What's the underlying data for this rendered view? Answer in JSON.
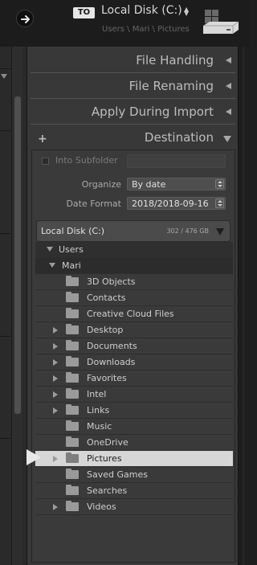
{
  "header": {
    "to_badge": "TO",
    "destination_name": "Local Disk (C:)",
    "destination_path": "Users \\ Mari \\ Pictures",
    "caret": "▲▼"
  },
  "panel": {
    "sections": [
      {
        "label": "File Handling",
        "state": "collapsed"
      },
      {
        "label": "File Renaming",
        "state": "collapsed"
      },
      {
        "label": "Apply During Import",
        "state": "collapsed"
      },
      {
        "label": "Destination",
        "state": "expanded"
      }
    ],
    "plus_icon": "+",
    "into_subfolder": {
      "label": "Into Subfolder",
      "value": ""
    },
    "organize": {
      "label": "Organize",
      "value": "By date"
    },
    "date_format": {
      "label": "Date Format",
      "value": "2018/2018-09-16"
    },
    "disk": {
      "name": "Local Disk (C:)",
      "space": "302 / 476 GB"
    },
    "tree": {
      "users": "Users",
      "mari": "Mari",
      "folders": [
        {
          "name": "3D Objects",
          "expandable": false
        },
        {
          "name": "Contacts",
          "expandable": false
        },
        {
          "name": "Creative Cloud Files",
          "expandable": false
        },
        {
          "name": "Desktop",
          "expandable": true
        },
        {
          "name": "Documents",
          "expandable": true
        },
        {
          "name": "Downloads",
          "expandable": true
        },
        {
          "name": "Favorites",
          "expandable": true
        },
        {
          "name": "Intel",
          "expandable": true
        },
        {
          "name": "Links",
          "expandable": true
        },
        {
          "name": "Music",
          "expandable": false
        },
        {
          "name": "OneDrive",
          "expandable": false
        },
        {
          "name": "Pictures",
          "expandable": true,
          "selected": true
        },
        {
          "name": "Saved Games",
          "expandable": false
        },
        {
          "name": "Searches",
          "expandable": false
        },
        {
          "name": "Videos",
          "expandable": true
        }
      ]
    }
  }
}
